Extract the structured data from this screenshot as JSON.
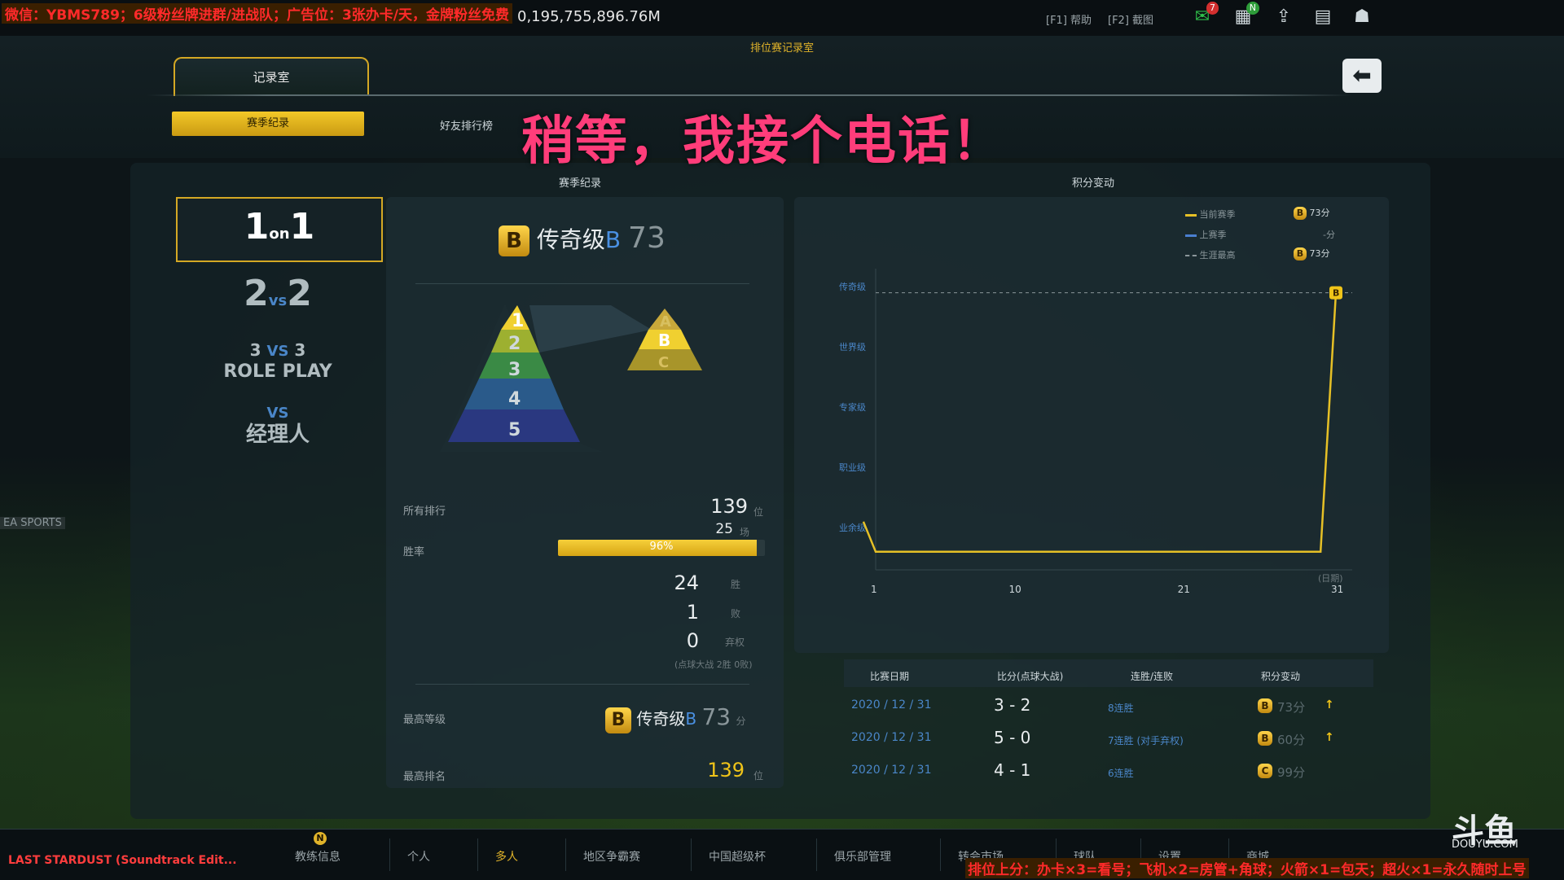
{
  "topbar": {
    "ticker": "微信：YBMS789；6级粉丝牌进群/进战队；广告位：3张办卡/天，金牌粉丝免费",
    "money": "0,195,755,896.76M",
    "help": "[F1] 帮助",
    "screenshot": "[F2] 截图",
    "mail_count": "7",
    "new_badge": "N"
  },
  "window_title": "排位赛记录室",
  "tabs": {
    "main": "记录室",
    "season": "赛季纪录",
    "friends": "好友排行榜"
  },
  "overlay_text": "稍等，我接个电话！",
  "modes": {
    "m1": {
      "a": "1",
      "b": "on",
      "c": "1"
    },
    "m2": {
      "a": "2",
      "b": "vs",
      "c": "2"
    },
    "m3": {
      "a": "3",
      "b": "VS",
      "c": "3",
      "d": "ROLE PLAY"
    },
    "m4": {
      "a": "VS",
      "b": "经理人"
    }
  },
  "season_record": {
    "title": "赛季纪录",
    "rank_icon": "B",
    "rank_name": "传奇级",
    "rank_letter": "B",
    "rank_points": "73",
    "pyramid_levels": [
      "1",
      "2",
      "3",
      "4",
      "5"
    ],
    "pyramid_sub": [
      "A",
      "B",
      "C"
    ],
    "all_rank_label": "所有排行",
    "all_rank": "139",
    "rank_unit": "位",
    "games": "25",
    "games_unit": "场",
    "winrate_label": "胜率",
    "winrate_text": "96%",
    "winrate_value": 0.96,
    "wins": "24",
    "wins_unit": "胜",
    "losses": "1",
    "losses_unit": "败",
    "forfeits": "0",
    "forfeits_unit": "弃权",
    "note": "(点球大战 2胜 0败)",
    "best_level_label": "最高等级",
    "best_level_icon": "B",
    "best_level_name": "传奇级",
    "best_level_letter": "B",
    "best_level_points": "73",
    "points_unit": "分",
    "best_rank_label": "最高排名",
    "best_rank": "139",
    "best_rank_unit": "位"
  },
  "points_change": {
    "title": "积分变动",
    "legend": [
      {
        "label": "当前赛季",
        "icon": "B",
        "value": "73分",
        "color": "#e6c026"
      },
      {
        "label": "上赛季",
        "icon": "",
        "value": "-分",
        "color": "#4a7fd0"
      },
      {
        "label": "生涯最高",
        "icon": "B",
        "value": "73分",
        "color": "#8a969a"
      }
    ]
  },
  "chart_data": {
    "type": "line",
    "title": "积分变动",
    "xlabel": "(日期)",
    "ylabel": "",
    "y_categories": [
      "业余级",
      "职业级",
      "专家级",
      "世界级",
      "传奇级"
    ],
    "x_ticks": [
      1,
      10,
      21,
      31
    ],
    "xlim": [
      1,
      31
    ],
    "ylim": [
      0,
      5
    ],
    "series": [
      {
        "name": "当前赛季",
        "x": [
          0.2,
          1,
          30,
          31
        ],
        "y": [
          0.8,
          0.3,
          0.3,
          4.6
        ],
        "end_marker": "B"
      }
    ],
    "reference_line": {
      "name": "生涯最高",
      "y": 4.6
    },
    "grid": false
  },
  "history": {
    "headers": [
      "比赛日期",
      "比分(点球大战)",
      "连胜/连败",
      "积分变动"
    ],
    "rows": [
      {
        "date": "2020 / 12 / 31",
        "score": "3 - 2",
        "streak": "8连胜",
        "icon": "B",
        "points": "73分",
        "arrow": "↑"
      },
      {
        "date": "2020 / 12 / 31",
        "score": "5 - 0",
        "streak": "7连胜 (对手弃权)",
        "icon": "B",
        "points": "60分",
        "arrow": "↑"
      },
      {
        "date": "2020 / 12 / 31",
        "score": "4 - 1",
        "streak": "6连胜",
        "icon": "C",
        "points": "99分",
        "arrow": ""
      }
    ]
  },
  "bottom_nav": {
    "items": [
      "教练信息",
      "个人",
      "多人",
      "地区争霸赛",
      "中国超级杯",
      "俱乐部管理",
      "转会市场",
      "球队",
      "设置",
      "商城"
    ],
    "active": "多人",
    "badge": "N"
  },
  "song": "LAST STARDUST (Soundtrack Edit...",
  "bottom_ticker": "排位上分：办卡×3=看号；飞机×2=房管+角球；火箭×1=包天；超火×1=永久随时上号",
  "stream_logo": "斗鱼",
  "stream_domain": "DOUYU.COM",
  "watermark": "EA SPORTS"
}
